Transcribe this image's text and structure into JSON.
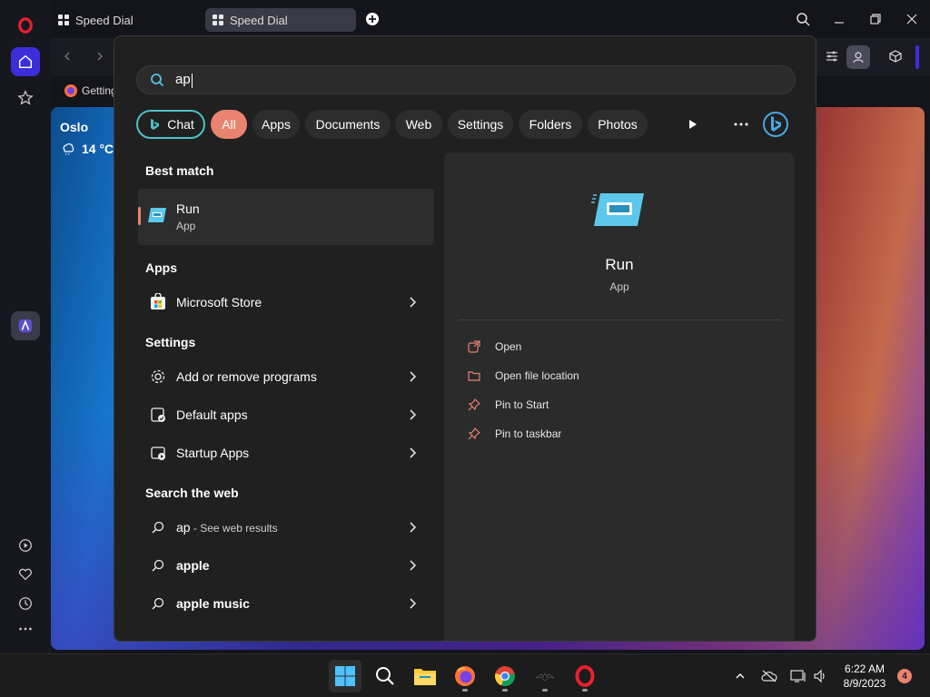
{
  "browser": {
    "tabs": [
      {
        "label": "Speed Dial",
        "active": false
      },
      {
        "label": "Speed Dial",
        "active": true
      }
    ],
    "bookmark_label": "Getting",
    "weather": {
      "city": "Oslo",
      "temp": "14 °C"
    }
  },
  "search": {
    "query": "ap",
    "filters": {
      "chat": "Chat",
      "all": "All",
      "apps": "Apps",
      "documents": "Documents",
      "web": "Web",
      "settings": "Settings",
      "folders": "Folders",
      "photos": "Photos"
    },
    "best_match": {
      "heading": "Best match",
      "title": "Run",
      "subtitle": "App"
    },
    "apps": {
      "heading": "Apps",
      "items": [
        {
          "label": "Microsoft Store"
        }
      ]
    },
    "settings": {
      "heading": "Settings",
      "items": [
        {
          "label": "Add or remove programs"
        },
        {
          "label": "Default apps"
        },
        {
          "label": "Startup Apps"
        }
      ]
    },
    "web": {
      "heading": "Search the web",
      "items": [
        {
          "label": "ap",
          "suffix": " - See web results"
        },
        {
          "label": "apple"
        },
        {
          "label": "apple music"
        }
      ]
    },
    "preview": {
      "title": "Run",
      "subtitle": "App",
      "actions": [
        {
          "label": "Open",
          "icon": "open-icon"
        },
        {
          "label": "Open file location",
          "icon": "folder-icon"
        },
        {
          "label": "Pin to Start",
          "icon": "pin-icon"
        },
        {
          "label": "Pin to taskbar",
          "icon": "pin-icon"
        }
      ]
    }
  },
  "taskbar": {
    "time": "6:22 AM",
    "date": "8/9/2023",
    "notifications": "4"
  },
  "colors": {
    "accent": "#e8836f",
    "chat_border": "#4ec0c8",
    "popup_bg": "#202020",
    "opera_red": "#e8202e"
  }
}
